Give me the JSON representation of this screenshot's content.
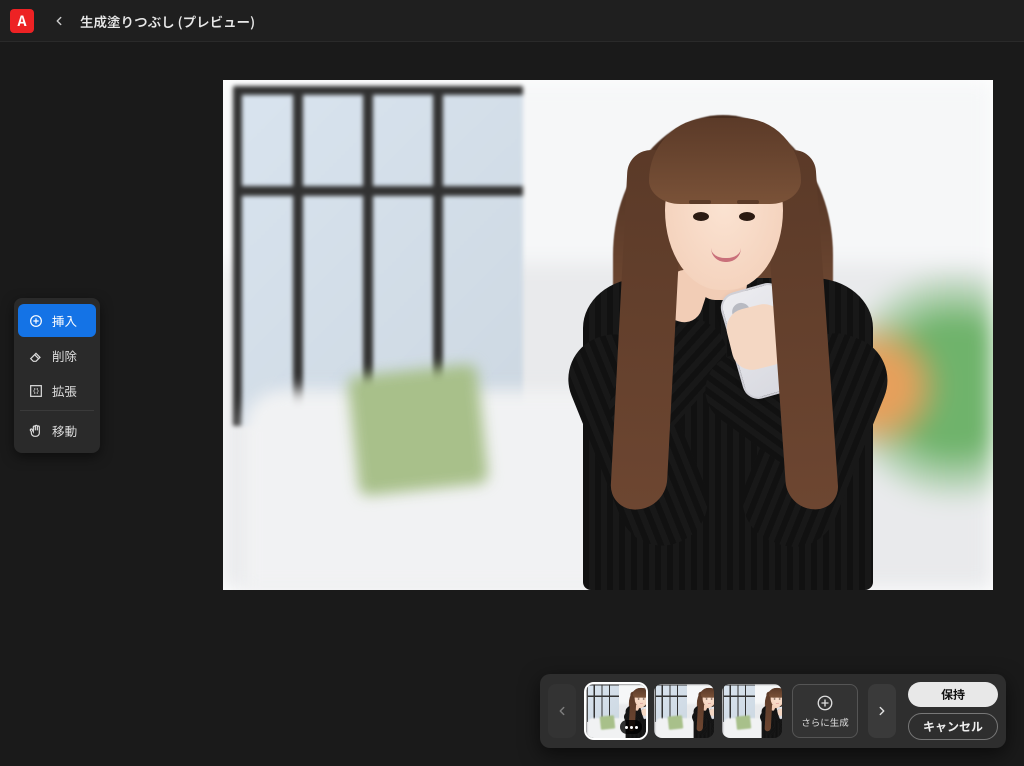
{
  "app": {
    "logo_letter": "A"
  },
  "header": {
    "title": "生成塗りつぶし (プレビュー)"
  },
  "tools": {
    "items": [
      {
        "id": "insert",
        "label": "挿入",
        "active": true
      },
      {
        "id": "remove",
        "label": "削除",
        "active": false
      },
      {
        "id": "expand",
        "label": "拡張",
        "active": false
      },
      {
        "id": "move",
        "label": "移動",
        "active": false
      }
    ]
  },
  "variations": {
    "selected_index": 0,
    "count": 3,
    "generate_more_label": "さらに生成"
  },
  "actions": {
    "keep_label": "保持",
    "cancel_label": "キャンセル"
  }
}
